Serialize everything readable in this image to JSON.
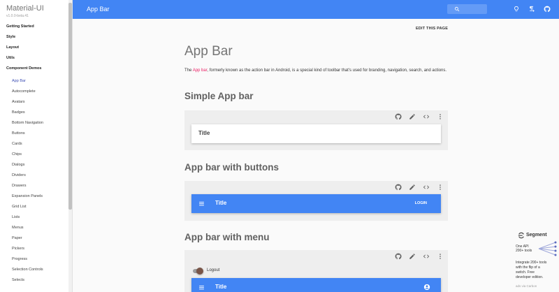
{
  "sidebar": {
    "brand": "Material-UI",
    "version": "v1.0.0-beta.41",
    "top_items": [
      "Getting Started",
      "Style",
      "Layout",
      "Utils",
      "Component Demos"
    ],
    "sub_items": [
      "App Bar",
      "Autocomplete",
      "Avatars",
      "Badges",
      "Bottom Navigation",
      "Buttons",
      "Cards",
      "Chips",
      "Dialogs",
      "Dividers",
      "Drawers",
      "Expansion Panels",
      "Grid List",
      "Lists",
      "Menus",
      "Paper",
      "Pickers",
      "Progress",
      "Selection Controls",
      "Selects"
    ],
    "active_item": "App Bar"
  },
  "topbar": {
    "title": "App Bar",
    "icons": [
      "search-icon",
      "lightbulb-icon",
      "text-direction-icon",
      "github-icon"
    ]
  },
  "main": {
    "edit_link": "EDIT THIS PAGE",
    "title": "App Bar",
    "intro_before": "The ",
    "intro_link": "App bar",
    "intro_after": ", formerly known as the action bar in Android, is a special kind of toolbar that's used for branding, navigation, search, and actions.",
    "sections": [
      {
        "title": "Simple App bar",
        "bar_title": "Title"
      },
      {
        "title": "App bar with buttons",
        "bar_title": "Title",
        "action": "LOGIN"
      },
      {
        "title": "App bar with menu",
        "switch_label": "Logout",
        "bar_title": "Title"
      }
    ],
    "demo_tool_icons": [
      "github-icon",
      "edit-icon",
      "code-icon",
      "more-vert-icon"
    ]
  },
  "ad": {
    "brand": "Segment",
    "art_lines": [
      "One API",
      "200+ tools"
    ],
    "lines": [
      "Integrate 200+ tools",
      "with the flip of a",
      "switch. Free",
      "developer edition."
    ],
    "footer": "ads via Carbon"
  },
  "colors": {
    "primary": "#4285f4",
    "link": "#e91e63",
    "active_nav": "#3f51b5",
    "demo_bg": "#eeeeee"
  }
}
